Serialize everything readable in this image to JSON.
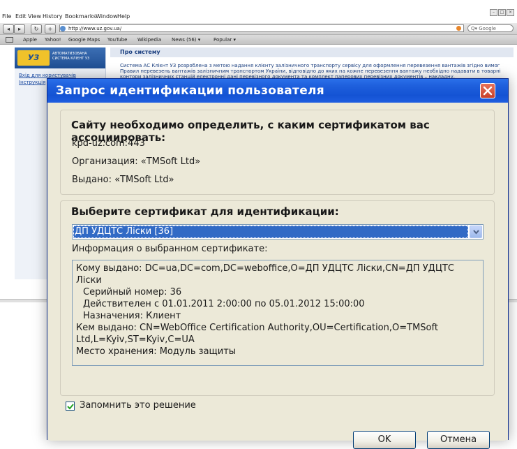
{
  "browser": {
    "menu": [
      "File",
      "Edit",
      "View",
      "History",
      "Bookmarks",
      "Window",
      "Help"
    ],
    "url": "http://www.uz.gov.ua/",
    "search_placeholder": "Google",
    "bookmarks": [
      "Apple",
      "Yahoo!",
      "Google Maps",
      "YouTube",
      "Wikipedia",
      "News (56) ▾",
      "Popular ▾"
    ]
  },
  "page": {
    "logo_mark": "УЗ",
    "logo_text": "АВТОМАТИЗОВАНА СИСТЕМА КЛІЄНТ УЗ",
    "links": [
      "Вхід для користувачів",
      "Інструкція"
    ],
    "section_title": "Про систему",
    "section_text": "Система АС Клієнт УЗ розроблена з метою надання клієнту залізничного транспорту сервісу для оформлення перевезення вантажів згідно вимог Правил перевезень вантажів залізничним транспортом України, відповідно до яких на кожне перевезення вантажу необхідно надавати в товарні контори залізничних станцій електронні дані перевізного документа та комплект паперових перевізних документів – накладну."
  },
  "dialog": {
    "title": "Запрос идентификации пользователя",
    "group1": {
      "heading": "Сайту необходимо определить, с каким сертификатом вас ассоциировать:",
      "host": "kpd-uz.com:443",
      "organization": "Организация: «TMSoft Ltd»",
      "issued": "Выдано: «TMSoft Ltd»"
    },
    "group2": {
      "heading": "Выберите сертификат для идентификации:",
      "selected_cert": "ДП УДЦТС Лiски [36]",
      "info_label": "Информация о выбранном сертификате:",
      "info_lines": [
        "Кому выдано: DC=ua,DC=com,DC=weboffice,O=ДП УДЦТС Лiски,CN=ДП УДЦТС Лiски",
        "Серийный номер: 36",
        "Действителен с 01.01.2011 2:00:00 по 05.01.2012 15:00:00",
        "Назначения: Клиент",
        "Кем выдано: CN=WebOffice Certification Authority,OU=Certification,O=TMSoft Ltd,L=Kyiv,ST=Kyiv,C=UA",
        "Место хранения: Модуль защиты"
      ]
    },
    "remember_label": "Запомнить это решение",
    "remember_checked": true,
    "ok_label": "OK",
    "cancel_label": "Отмена"
  },
  "colors": {
    "titlebar": "#1f5ee0",
    "selection": "#316ac5",
    "dialog_bg": "#ece9d8",
    "close_button": "#d4513a"
  }
}
